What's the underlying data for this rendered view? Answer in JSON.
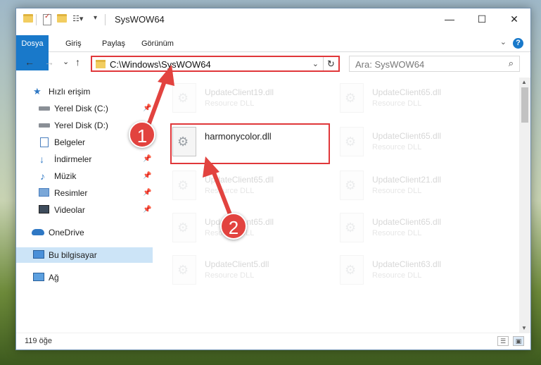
{
  "window": {
    "title": "SysWOW64",
    "minimize_glyph": "—",
    "maximize_glyph": "☐",
    "close_glyph": "✕"
  },
  "ribbon": {
    "tabs": [
      "Dosya",
      "Giriş",
      "Paylaş",
      "Görünüm"
    ],
    "help": "?",
    "collapse": "⌄"
  },
  "nav": {
    "back": "←",
    "forward": "→",
    "recent": "⌄",
    "up": "↑",
    "address": "C:\\Windows\\SysWOW64",
    "address_dropdown": "⌄",
    "refresh": "↻",
    "search_placeholder": "Ara: SysWOW64",
    "search_icon": "⌕"
  },
  "sidebar": {
    "items": [
      {
        "label": "Hızlı erişim",
        "icon": "star-icon",
        "pinned": false
      },
      {
        "label": "Yerel Disk (C:)",
        "icon": "drive-icon",
        "pinned": true
      },
      {
        "label": "Yerel Disk (D:)",
        "icon": "drive-icon",
        "pinned": true
      },
      {
        "label": "Belgeler",
        "icon": "documents-icon",
        "pinned": true
      },
      {
        "label": "İndirmeler",
        "icon": "download-icon",
        "pinned": true
      },
      {
        "label": "Müzik",
        "icon": "music-icon",
        "pinned": true
      },
      {
        "label": "Resimler",
        "icon": "pictures-icon",
        "pinned": true
      },
      {
        "label": "Videolar",
        "icon": "video-icon",
        "pinned": true
      },
      {
        "label": "OneDrive",
        "icon": "cloud-icon",
        "pinned": false
      },
      {
        "label": "Bu bilgisayar",
        "icon": "computer-icon",
        "pinned": false
      },
      {
        "label": "Ağ",
        "icon": "network-icon",
        "pinned": false
      }
    ],
    "pin_glyph": "📌"
  },
  "files": {
    "highlighted": {
      "name": "harmonycolor.dll"
    },
    "faded": [
      {
        "name": "UpdateClient19.dll",
        "type": "Resource DLL"
      },
      {
        "name": "UpdateClient65.dll",
        "type": "Resource DLL"
      },
      {
        "name": "UpdateClient65.dll",
        "type": "Resource DLL"
      },
      {
        "name": "UpdateClient65.dll",
        "type": "Resource DLL"
      },
      {
        "name": "UpdateClient21.dll",
        "type": "Resource DLL"
      },
      {
        "name": "UpdateClient65.dll",
        "type": "Resource DLL"
      },
      {
        "name": "UpdateClient65.dll",
        "type": "Resource DLL"
      },
      {
        "name": "UpdateClient5.dll",
        "type": "Resource DLL"
      },
      {
        "name": "UpdateClient63.dll",
        "type": "Resource DLL"
      }
    ]
  },
  "status": {
    "count": "119 öğe"
  },
  "annotations": {
    "step1": "1",
    "step2": "2",
    "accent": "#e0373a"
  }
}
